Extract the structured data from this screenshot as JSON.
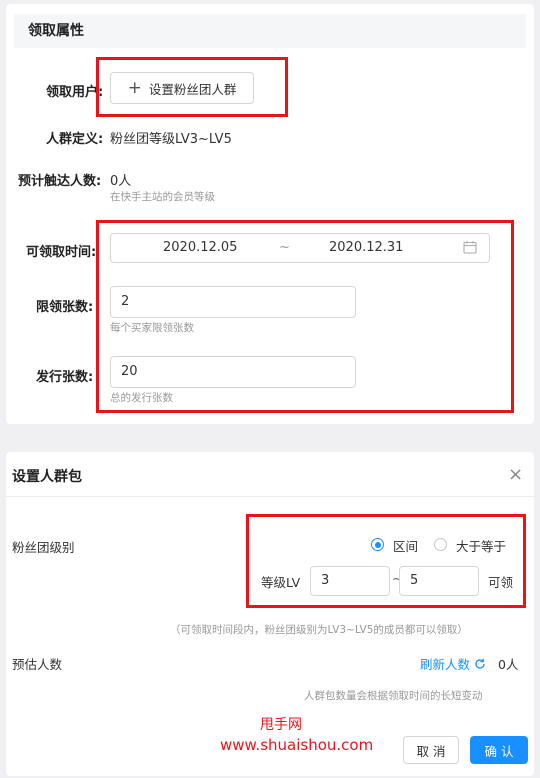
{
  "top_section": {
    "title": "领取属性",
    "claim_users_label": "领取用户:",
    "add_group_button": "设置粉丝团人群",
    "group_definition_label": "人群定义:",
    "group_definition_value": "粉丝团等级LV3~LV5",
    "reach_label": "预计触达人数:",
    "reach_value": "0人",
    "reach_hint": "在快手主站的会员等级",
    "claim_time_label": "可领取时间:",
    "date_start": "2020.12.05",
    "date_sep": "~",
    "date_end": "2020.12.31",
    "limit_label": "限领张数:",
    "limit_value": "2",
    "limit_hint": "每个买家限领张数",
    "issue_label": "发行张数:",
    "issue_value": "20",
    "issue_hint": "总的发行张数"
  },
  "dialog": {
    "title": "设置人群包",
    "close_glyph": "×",
    "fan_level_label": "粉丝团级别",
    "option_range": "区间",
    "option_gte": "大于等于",
    "selected_option": "区间",
    "level_prefix": "等级LV",
    "level_min": "3",
    "level_sep": "~",
    "level_max": "5",
    "level_suffix": "可领",
    "range_hint": "（可领取时间段内，粉丝团级别为LV3~LV5的成员都可以领取）",
    "estimate_label": "预估人数",
    "refresh_label": "刷新人数",
    "estimate_value": "0人",
    "estimate_hint": "人群包数量会根据领取时间的长短变动",
    "cancel_button": "取 消",
    "confirm_button": "确 认"
  },
  "watermark": {
    "line1": "甩手网",
    "line2": "www.shuaishou.com"
  },
  "colors": {
    "accent": "#1890ff",
    "highlight_red": "#e8141a"
  }
}
